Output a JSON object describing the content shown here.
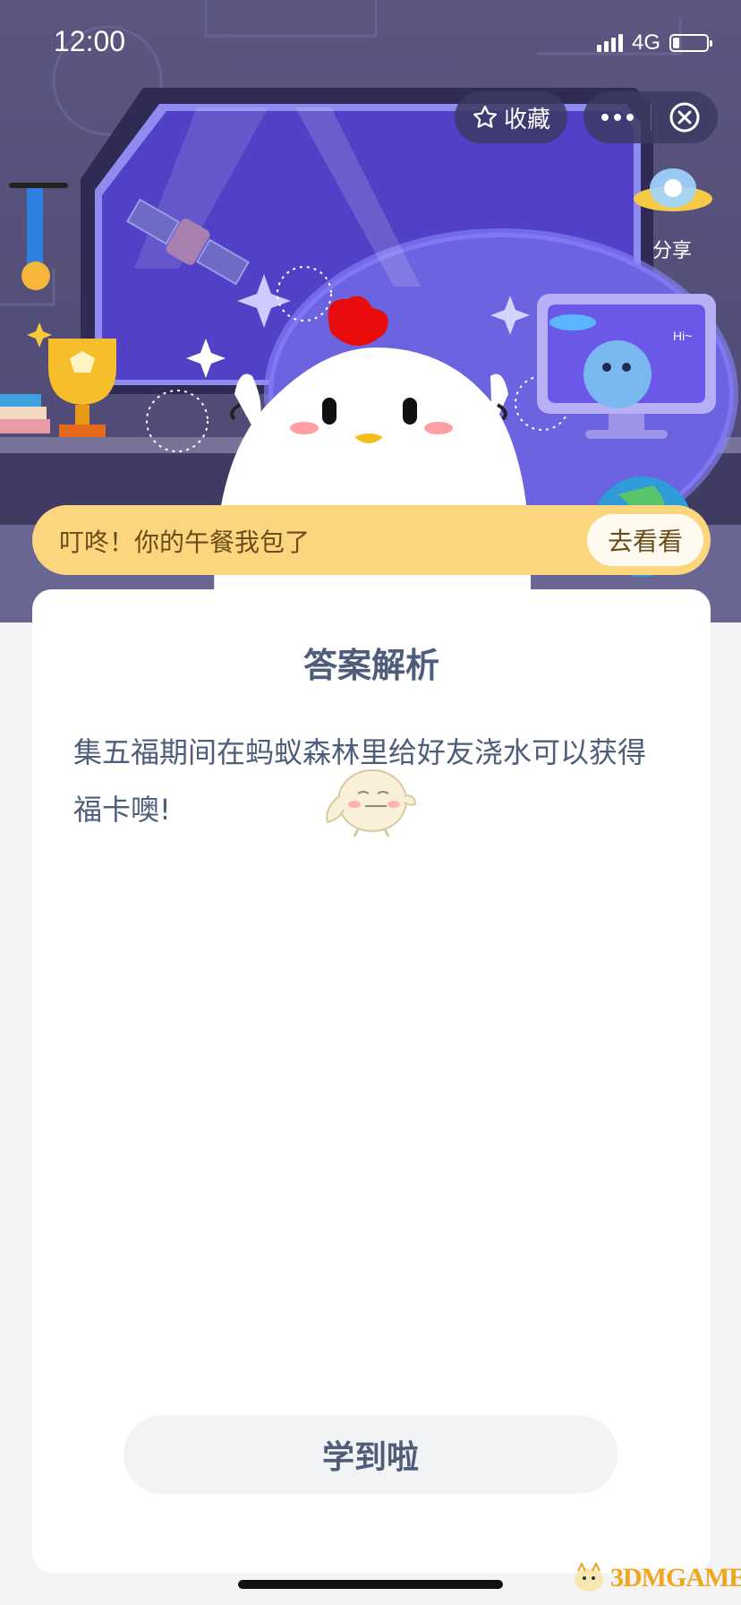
{
  "status_bar": {
    "time": "12:00",
    "network": "4G",
    "battery_level": 0.2
  },
  "header": {
    "favorite_label": "收藏",
    "share_label": "分享"
  },
  "banner": {
    "text": "叮咚！你的午餐我包了",
    "button_label": "去看看"
  },
  "card": {
    "title": "答案解析",
    "body": "集五福期间在蚂蚁森林里给好友浇水可以获得福卡噢!",
    "button_label": "学到啦"
  },
  "watermark": {
    "text": "3DMGAME"
  },
  "scene": {
    "alien_greeting": "Hi~"
  },
  "colors": {
    "hero_bg": "#514d78",
    "banner_bg": "#fbd67f",
    "text_primary": "#4e5d79",
    "chick_comb": "#e80c0c"
  }
}
